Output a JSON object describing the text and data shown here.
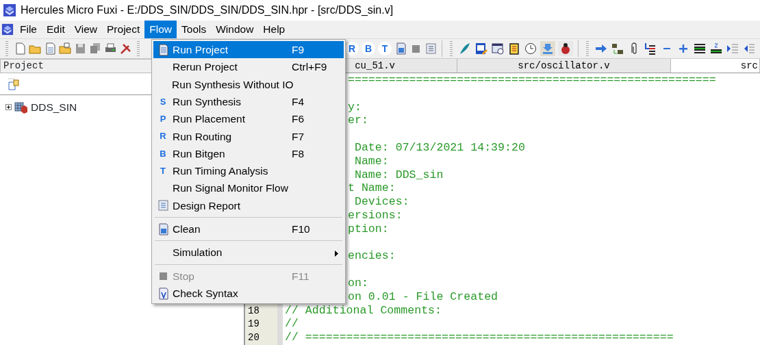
{
  "window": {
    "title": "Hercules Micro Fuxi - E:/DDS_SIN/DDS_SIN/DDS_SIN.hpr - [src/DDS_sin.v]"
  },
  "menu_bar": [
    {
      "label": "File",
      "selected": false
    },
    {
      "label": "Edit",
      "selected": false
    },
    {
      "label": "View",
      "selected": false
    },
    {
      "label": "Project",
      "selected": false
    },
    {
      "label": "Flow",
      "selected": true
    },
    {
      "label": "Tools",
      "selected": false
    },
    {
      "label": "Window",
      "selected": false
    },
    {
      "label": "Help",
      "selected": false
    }
  ],
  "toolbar": {
    "letter_buttons": [
      "R",
      "B",
      "T"
    ]
  },
  "project_panel": {
    "title": "Project",
    "tree": [
      {
        "label": "DDS_SIN",
        "expanded": false
      }
    ]
  },
  "editor_tabs": [
    {
      "label": "cu_51.v",
      "selected": false
    },
    {
      "label": "src/oscillator.v",
      "selected": false
    },
    {
      "label": "src",
      "selected": true
    }
  ],
  "code_lines": [
    {
      "kind": "code",
      "text": "======================================================"
    },
    {
      "kind": "blank"
    },
    {
      "kind": "code",
      "text": "y:"
    },
    {
      "kind": "code",
      "text": "er:"
    },
    {
      "kind": "blank"
    },
    {
      "kind": "code",
      "text": " Date: 07/13/2021 14:39:20"
    },
    {
      "kind": "code",
      "text": " Name:"
    },
    {
      "kind": "code",
      "text": " Name: DDS_sin"
    },
    {
      "kind": "code",
      "text": "t Name:"
    },
    {
      "kind": "code",
      "text": " Devices:"
    },
    {
      "kind": "code",
      "text": "ersions:"
    },
    {
      "kind": "code",
      "text": "ption:"
    },
    {
      "kind": "blank"
    },
    {
      "kind": "code",
      "text": "encies:"
    },
    {
      "kind": "blank"
    },
    {
      "kind": "code",
      "text": "on:"
    },
    {
      "kind": "code",
      "text": "on 0.01 - File Created"
    },
    {
      "kind": "code",
      "number": "18",
      "text": "// Additional Comments:"
    },
    {
      "kind": "code",
      "number": "19",
      "text": "//"
    },
    {
      "kind": "code",
      "number": "20",
      "text": "// ======================================================"
    }
  ],
  "flow_menu": [
    {
      "kind": "item",
      "label": "Run Project",
      "shortcut": "F9",
      "selected": true,
      "disabled": false
    },
    {
      "kind": "item",
      "label": "Rerun Project",
      "shortcut": "Ctrl+F9",
      "selected": false,
      "disabled": false
    },
    {
      "kind": "item",
      "label": "Run Synthesis Without IO",
      "selected": false,
      "disabled": false
    },
    {
      "kind": "item",
      "icon_letter": "S",
      "label": "Run Synthesis",
      "shortcut": "F4",
      "selected": false,
      "disabled": false
    },
    {
      "kind": "item",
      "icon_letter": "P",
      "label": "Run Placement",
      "shortcut": "F6",
      "selected": false,
      "disabled": false
    },
    {
      "kind": "item",
      "icon_letter": "R",
      "label": "Run Routing",
      "shortcut": "F7",
      "selected": false,
      "disabled": false
    },
    {
      "kind": "item",
      "icon_letter": "B",
      "label": "Run Bitgen",
      "shortcut": "F8",
      "selected": false,
      "disabled": false
    },
    {
      "kind": "item",
      "icon_letter": "T",
      "label": "Run Timing Analysis",
      "selected": false,
      "disabled": false
    },
    {
      "kind": "item",
      "label": "Run Signal Monitor Flow",
      "selected": false,
      "disabled": false
    },
    {
      "kind": "item",
      "label": "Design Report",
      "selected": false,
      "disabled": false
    },
    {
      "kind": "separator"
    },
    {
      "kind": "item",
      "label": "Clean",
      "shortcut": "F10",
      "selected": false,
      "disabled": false
    },
    {
      "kind": "separator"
    },
    {
      "kind": "submenu",
      "label": "Simulation",
      "selected": false,
      "disabled": false
    },
    {
      "kind": "separator"
    },
    {
      "kind": "item",
      "label": "Stop",
      "shortcut": "F11",
      "selected": false,
      "disabled": true
    },
    {
      "kind": "item",
      "label": "Check Syntax",
      "selected": false,
      "disabled": false
    }
  ]
}
